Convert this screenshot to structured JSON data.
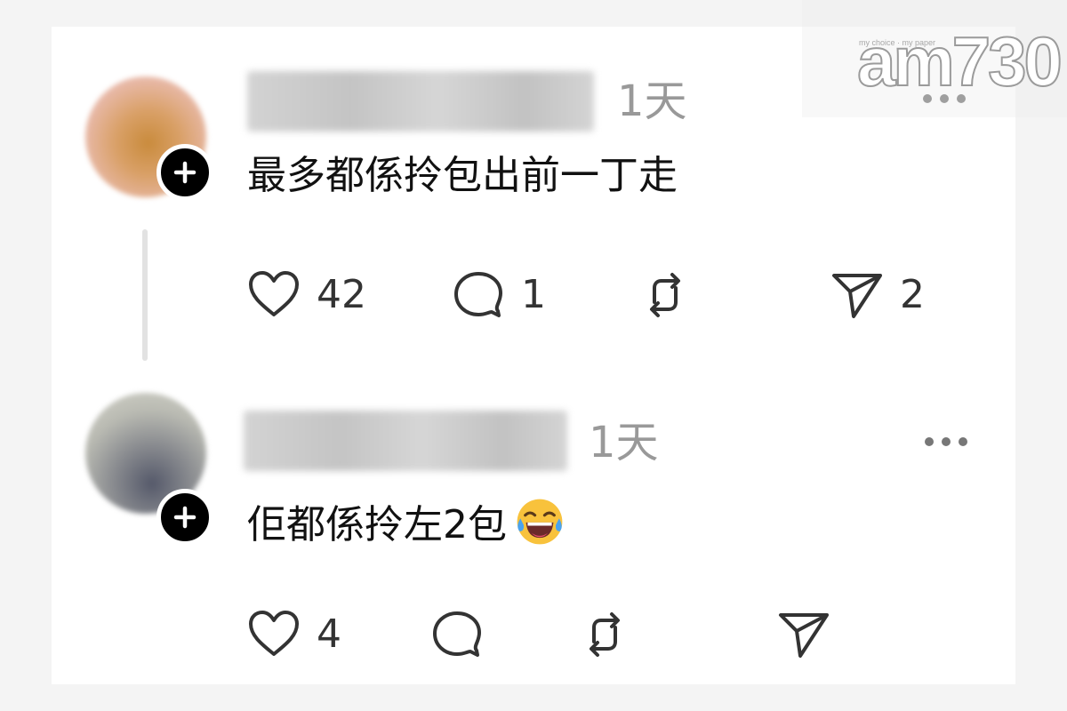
{
  "posts": [
    {
      "timestamp": "1天",
      "text": "最多都係拎包出前一丁走",
      "actions": {
        "likes": "42",
        "replies": "1",
        "reposts": "",
        "shares": "2"
      }
    },
    {
      "timestamp": "1天",
      "text": "佢都係拎左2包",
      "emoji": "face-with-tears-of-joy",
      "actions": {
        "likes": "4",
        "replies": "",
        "reposts": "",
        "shares": ""
      }
    }
  ],
  "watermark": {
    "logo_text": "am730",
    "tagline": "my choice · my paper"
  },
  "colors": {
    "background": "#f4f4f4",
    "card": "#ffffff",
    "text": "#111111",
    "muted": "#999999",
    "badge": "#000000"
  },
  "icons": [
    "plus-icon",
    "more-icon",
    "heart-icon",
    "comment-icon",
    "repost-icon",
    "share-icon"
  ]
}
